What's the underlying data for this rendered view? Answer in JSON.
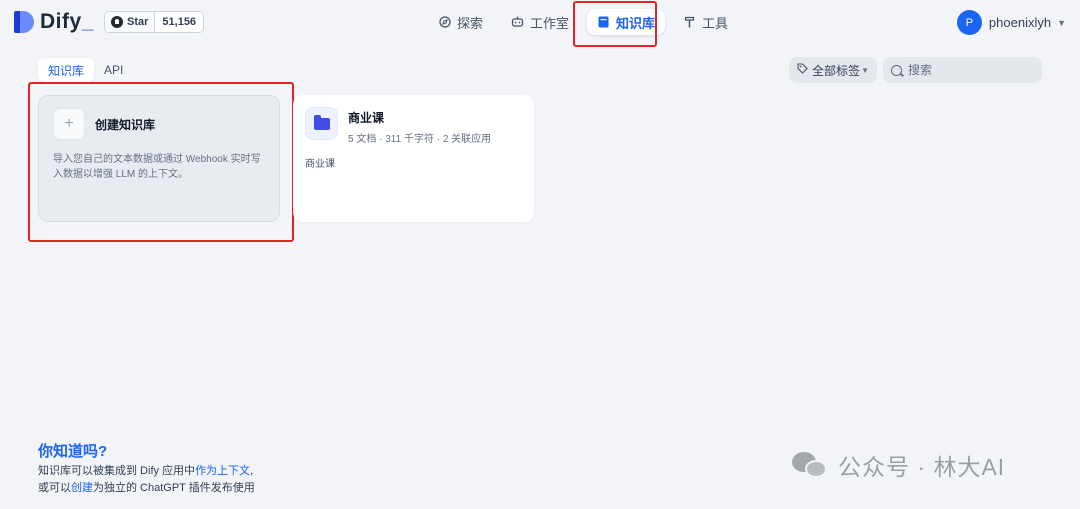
{
  "header": {
    "logo_text": "Dify",
    "github": {
      "label": "Star",
      "count": "51,156"
    },
    "nav": [
      {
        "label": "探索",
        "icon": "compass-icon"
      },
      {
        "label": "工作室",
        "icon": "robot-icon"
      },
      {
        "label": "知识库",
        "icon": "book-icon",
        "active": true
      },
      {
        "label": "工具",
        "icon": "hammer-icon"
      }
    ],
    "user": {
      "avatar_letter": "P",
      "name": "phoenixlyh"
    }
  },
  "tabs": [
    {
      "label": "知识库",
      "active": true
    },
    {
      "label": "API",
      "active": false
    }
  ],
  "filters": {
    "tag_label": "全部标签",
    "search_placeholder": "搜索"
  },
  "create_card": {
    "plus": "+",
    "title": "创建知识库",
    "description": "导入您自己的文本数据或通过 Webhook 实时写入数据以增强 LLM 的上下文。"
  },
  "datasets": [
    {
      "title": "商业课",
      "stats": "5 文档 · 311 千字符 · 2 关联应用",
      "description": "商业课"
    }
  ],
  "tip": {
    "title": "你知道吗?",
    "line1_a": "知识库可以被集成到 Dify 应用中",
    "line1_link": "作为上下文",
    "line1_b": ",",
    "line2_a": "或可以",
    "line2_link": "创建",
    "line2_b": "为独立的 ChatGPT 插件发布使用"
  },
  "watermark": "公众号 · 林大AI",
  "colors": {
    "accent": "#1c64f2",
    "highlight_box": "#e02424",
    "background": "#f2f4f7"
  }
}
